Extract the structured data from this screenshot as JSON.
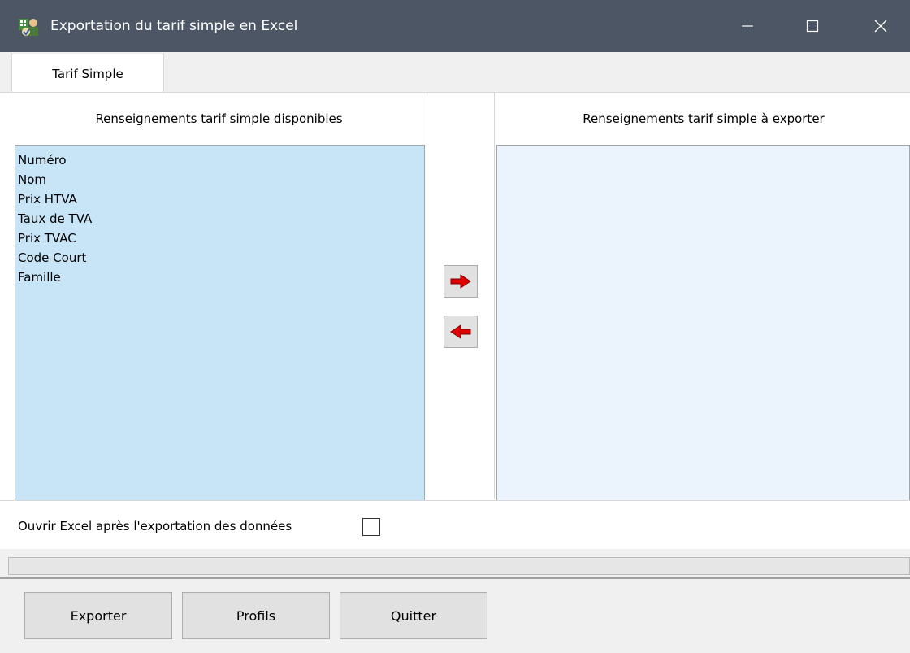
{
  "window": {
    "title": "Exportation du tarif simple en Excel",
    "app_icon": "excel-export-app-icon",
    "controls": {
      "minimize": "minimize-icon",
      "maximize": "maximize-icon",
      "close": "close-icon"
    }
  },
  "tabs": [
    {
      "label": "Tarif Simple",
      "selected": true
    }
  ],
  "available": {
    "header": "Renseignements tarif simple disponibles",
    "items": [
      "Numéro",
      "Nom",
      "Prix HTVA",
      "Taux de TVA",
      "Prix TVAC",
      "Code Court",
      "Famille"
    ]
  },
  "to_export": {
    "header": "Renseignements tarif simple à exporter",
    "items": []
  },
  "transfer": {
    "add_icon": "arrow-right-icon",
    "remove_icon": "arrow-left-icon"
  },
  "open_excel": {
    "label": "Ouvrir Excel après l'exportation des données",
    "checked": false
  },
  "progress": {
    "value": 0
  },
  "buttons": {
    "export": "Exporter",
    "profiles": "Profils",
    "quit": "Quitter"
  },
  "colors": {
    "titlebar": "#4c5664",
    "available_list_bg": "#c8e5f8",
    "export_list_bg": "#ebf4fd",
    "arrow_red": "#e00000"
  }
}
